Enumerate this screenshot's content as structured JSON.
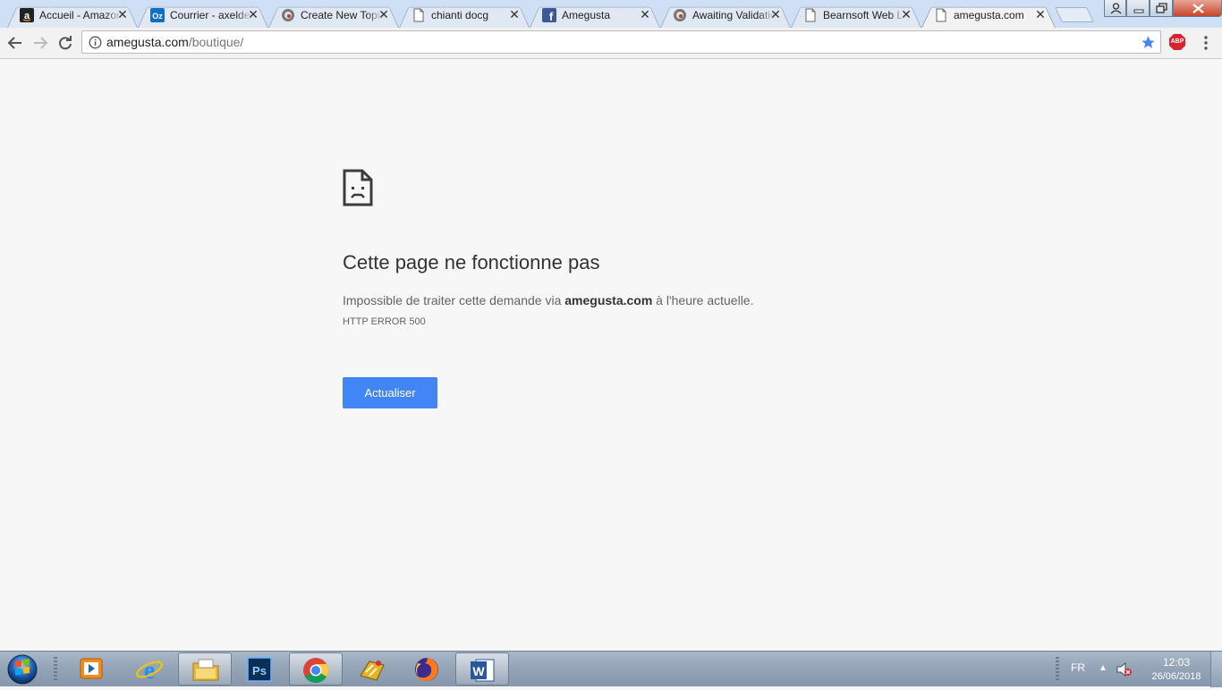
{
  "browser": {
    "tabs": [
      {
        "title": "Accueil - Amazon",
        "icon": "amazon-icon",
        "active": false
      },
      {
        "title": "Courrier - axelde",
        "icon": "outlook-icon",
        "active": false
      },
      {
        "title": "Create New Topic",
        "icon": "forum-icon",
        "active": false
      },
      {
        "title": "chianti docg",
        "icon": "page-icon",
        "active": false
      },
      {
        "title": "Amegusta",
        "icon": "facebook-icon",
        "active": false
      },
      {
        "title": "Awaiting Validation",
        "icon": "forum-icon",
        "active": false
      },
      {
        "title": "Bearnsoft Web L",
        "icon": "page-icon",
        "active": false
      },
      {
        "title": "amegusta.com",
        "icon": "page-icon",
        "active": true
      }
    ],
    "url_domain": "amegusta.com",
    "url_path": "/boutique/",
    "extension_label": "ABP"
  },
  "error_page": {
    "title": "Cette page ne fonctionne pas",
    "message_before": "Impossible de traiter cette demande via ",
    "message_domain": "amegusta.com",
    "message_after": " à l'heure actuelle.",
    "code": "HTTP ERROR 500",
    "reload_label": "Actualiser"
  },
  "taskbar": {
    "apps": [
      {
        "name": "media-player-icon",
        "open": false
      },
      {
        "name": "internet-explorer-icon",
        "open": false
      },
      {
        "name": "file-explorer-icon",
        "open": true
      },
      {
        "name": "photoshop-icon",
        "open": false
      },
      {
        "name": "chrome-icon",
        "open": true
      },
      {
        "name": "game-icon",
        "open": false
      },
      {
        "name": "firefox-icon",
        "open": false
      },
      {
        "name": "word-icon",
        "open": true
      }
    ],
    "language": "FR",
    "time": "12:03",
    "date": "26/06/2018"
  },
  "colors": {
    "accent": "#4285f4",
    "tabstrip": "#cfe0f4",
    "page_background": "#f7f7f7"
  }
}
